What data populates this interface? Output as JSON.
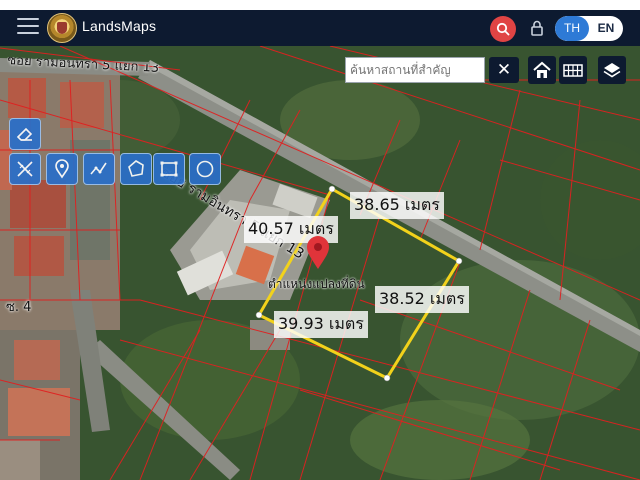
{
  "header": {
    "app_title": "LandsMaps",
    "lang_th": "TH",
    "lang_en": "EN",
    "active_lang": "TH"
  },
  "map_controls": {
    "search_placeholder": "ค้นหาสถานที่สำคัญ",
    "clear_label": "✕"
  },
  "tools": [
    "eraser-icon",
    "ruler-icon",
    "pin-tool-icon",
    "polyline-icon",
    "polygon-icon",
    "rectangle-icon",
    "circle-icon"
  ],
  "measurements": {
    "top_right": "38.65 เมตร",
    "top_left": "40.57 เมตร",
    "right": "38.52 เมตร",
    "bottom": "39.93 เมตร"
  },
  "parcel_label": "ตำแหน่งแปลงที่ดิน",
  "road_labels": {
    "main_road": "ซอย รามอินทรา 5 แยก 13",
    "top_road": "ซอย รามอินทรา 5 แยก 13",
    "side_road": "ซ. 4"
  },
  "colors": {
    "header_bg": "#0d1a30",
    "accent_blue": "#2e7ad6",
    "search_red": "#e04444",
    "parcel_yellow": "#f2d21b",
    "cadastral_red": "#e02020"
  }
}
